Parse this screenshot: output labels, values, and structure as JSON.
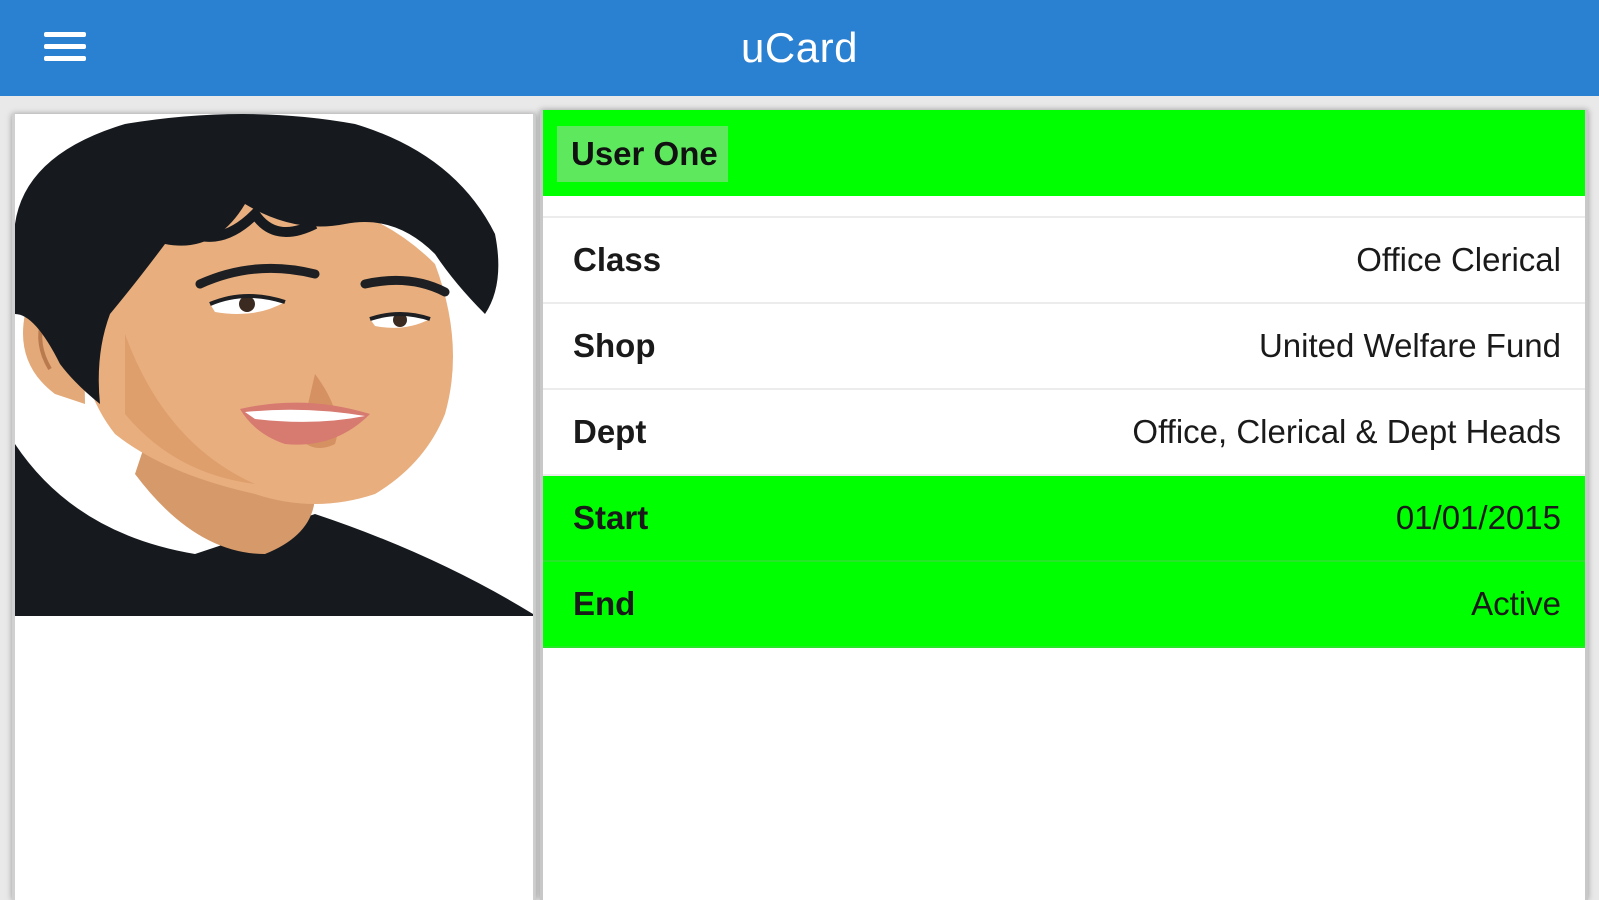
{
  "header": {
    "title": "uCard",
    "menu_icon": "hamburger-menu-icon",
    "background_color": "#2a80d1"
  },
  "profile": {
    "photo": "user-avatar-illustration"
  },
  "card": {
    "name": "User One",
    "highlight_color": "#00ff00",
    "rows": [
      {
        "label": "Class",
        "value": "Office Clerical",
        "highlight": false
      },
      {
        "label": "Shop",
        "value": "United Welfare Fund",
        "highlight": false
      },
      {
        "label": "Dept",
        "value": "Office, Clerical & Dept Heads",
        "highlight": false
      },
      {
        "label": "Start",
        "value": "01/01/2015",
        "highlight": true
      },
      {
        "label": "End",
        "value": "Active",
        "highlight": true
      }
    ]
  }
}
